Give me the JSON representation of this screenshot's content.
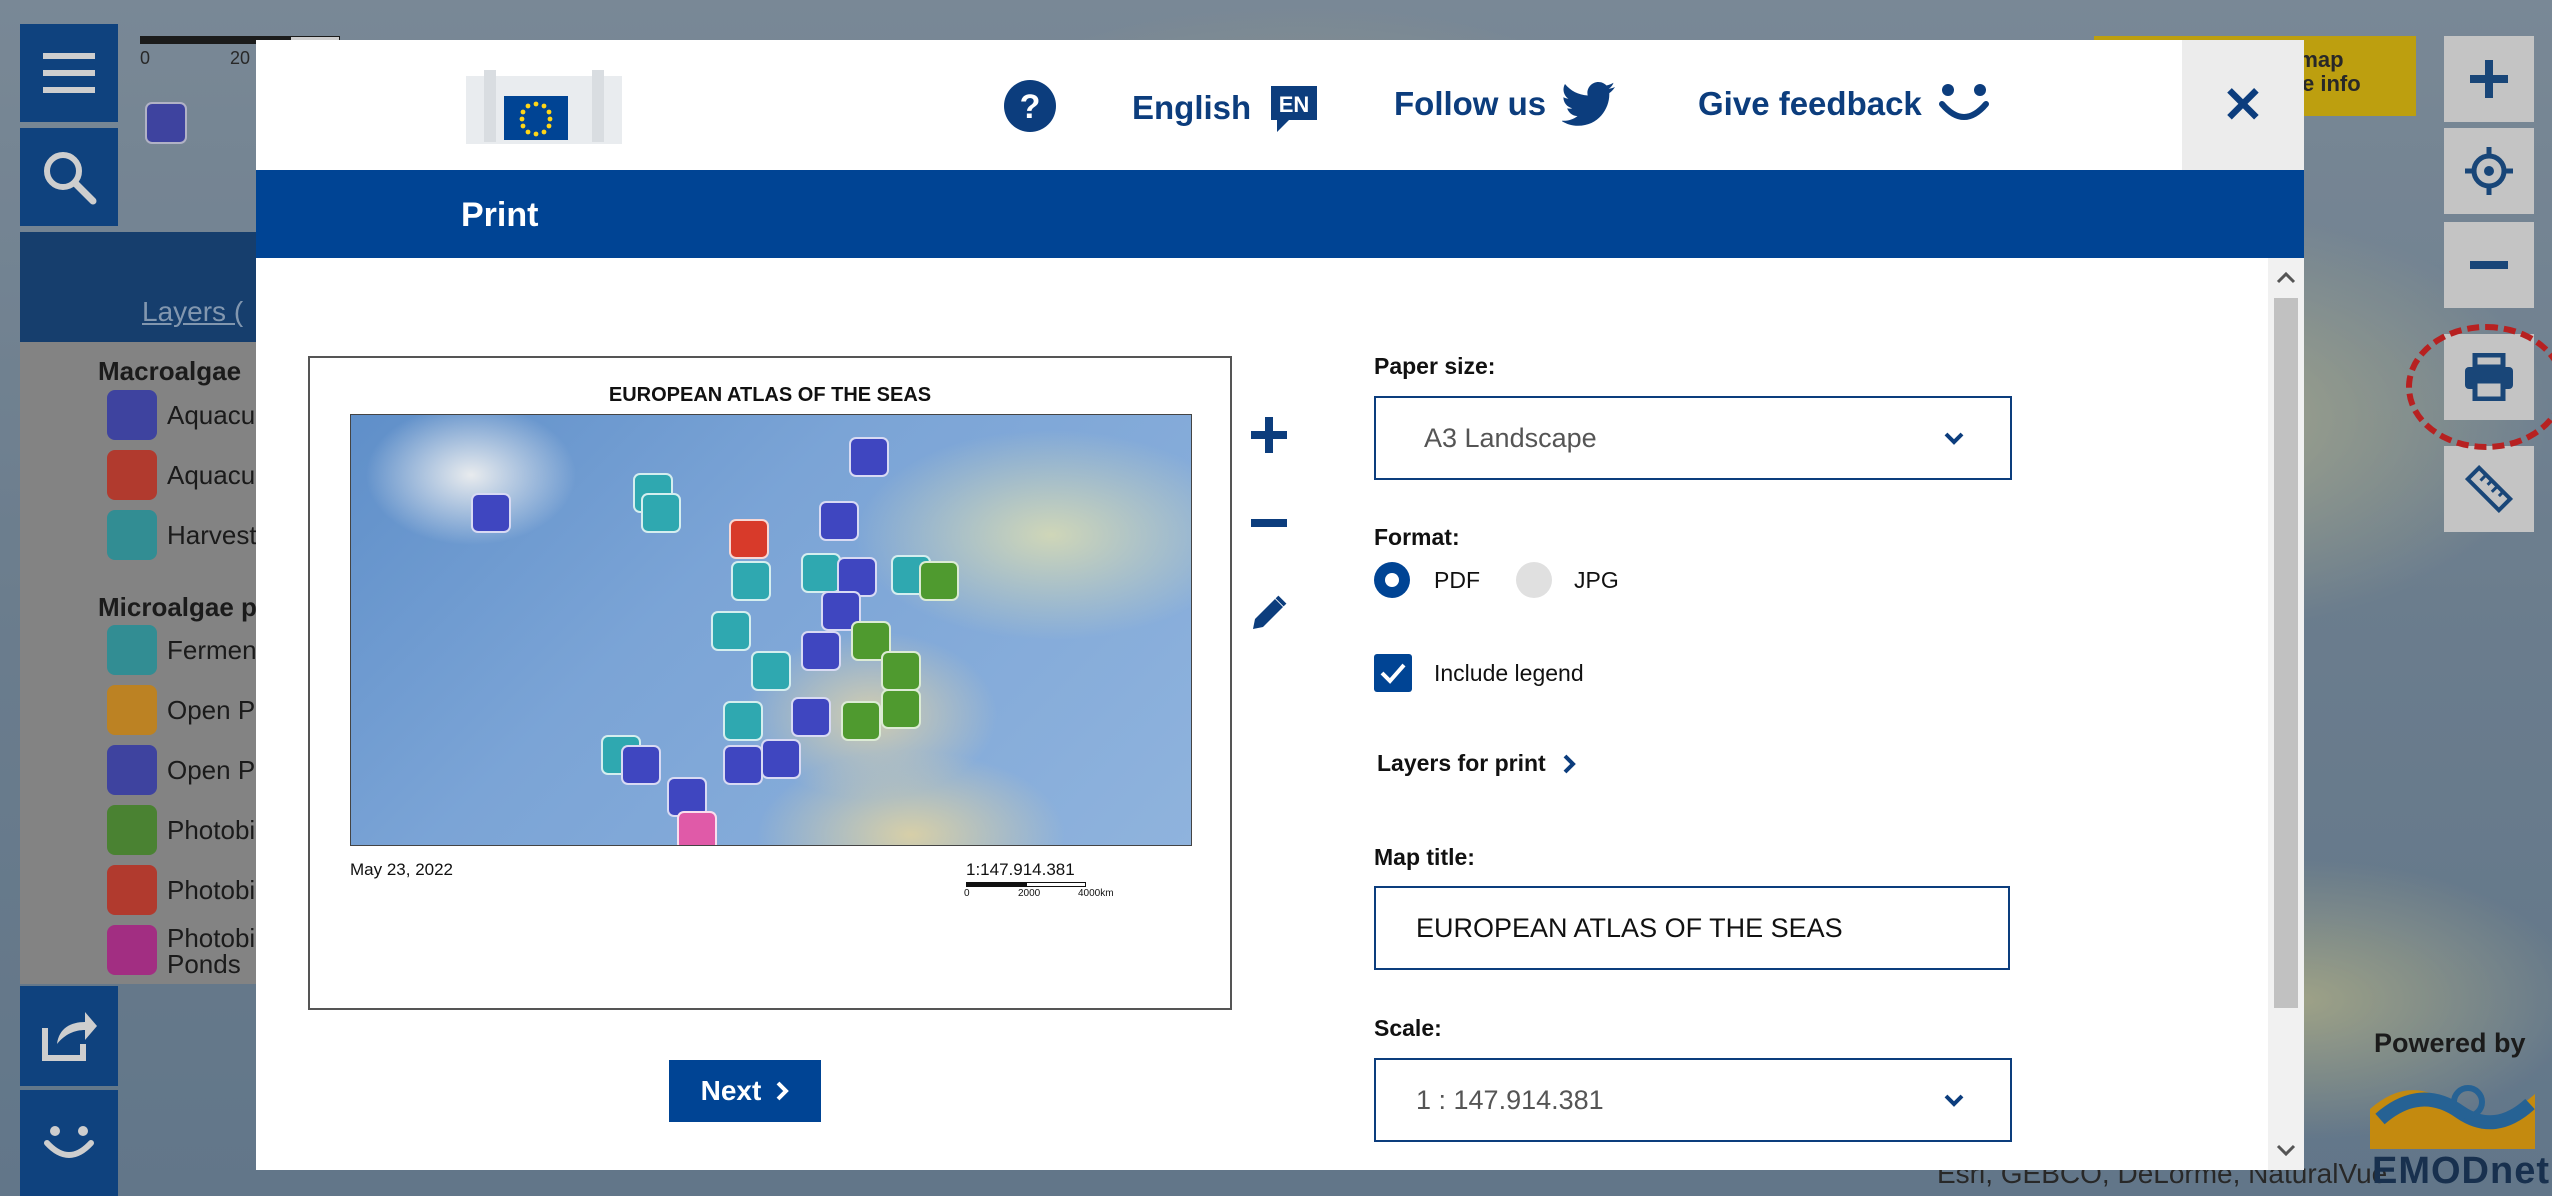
{
  "header": {
    "language_label": "English",
    "language_code": "EN",
    "follow_label": "Follow us",
    "feedback_label": "Give feedback",
    "close_symbol": "✕"
  },
  "dialog": {
    "title": "Print"
  },
  "preview": {
    "map_title": "EUROPEAN ATLAS OF THE SEAS",
    "date": "May 23, 2022",
    "scale": "1:147.914.381",
    "scalebar_labels": [
      "0",
      "2000",
      "4000km"
    ]
  },
  "form": {
    "paper_size_label": "Paper size:",
    "paper_size_value": "A3 Landscape",
    "format_label": "Format:",
    "format_options": [
      "PDF",
      "JPG"
    ],
    "format_selected": "PDF",
    "include_legend_label": "Include legend",
    "include_legend_checked": true,
    "layers_for_print_label": "Layers for print",
    "map_title_label": "Map title:",
    "map_title_value": "EUROPEAN ATLAS OF THE SEAS",
    "scale_label": "Scale:",
    "scale_value": "1 : 147.914.381"
  },
  "next_button": "Next",
  "background": {
    "scale_ticks": [
      "0",
      "20"
    ],
    "layers_link": "Layers (",
    "groups": [
      {
        "title": "Macroalgae",
        "items": [
          "Aquacu",
          "Aquacu",
          "Harvest"
        ],
        "colors": [
          "#3f46c0",
          "#d83a2a",
          "#2fa8b0"
        ]
      },
      {
        "title": "Microalgae p",
        "items": [
          "Fermen",
          "Open P",
          "Open P",
          "Photobi",
          "Photobi",
          "Photobi"
        ],
        "extra": "Ponds",
        "colors": [
          "#2fa8b0",
          "#e79a1b",
          "#3f46c0",
          "#4f9a2f",
          "#d83a2a",
          "#c42a9a"
        ]
      }
    ],
    "yellow_note": [
      "e map",
      "ure info"
    ],
    "attribution": "Esri, GEBCO, DeLorme, NaturalVue",
    "powered_by": "Powered by",
    "emodnet": "EMODnet"
  },
  "colors": {
    "primary": "#004494",
    "highlight": "#e01818",
    "yellow": "#e8c100"
  }
}
